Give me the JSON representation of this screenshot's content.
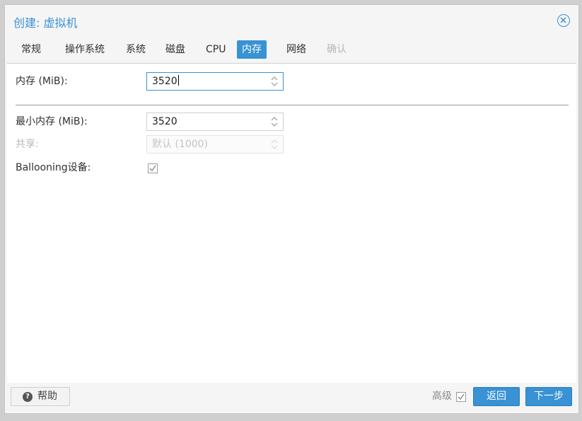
{
  "dialog": {
    "title": "创建: 虚拟机",
    "close_icon": "close-circle-icon"
  },
  "tabs": [
    {
      "label": "常规",
      "state": "normal"
    },
    {
      "label": "操作系统",
      "state": "normal"
    },
    {
      "label": "系统",
      "state": "normal"
    },
    {
      "label": "磁盘",
      "state": "normal"
    },
    {
      "label": "CPU",
      "state": "normal"
    },
    {
      "label": "内存",
      "state": "active"
    },
    {
      "label": "网络",
      "state": "normal"
    },
    {
      "label": "确认",
      "state": "disabled"
    }
  ],
  "form": {
    "memory": {
      "label": "内存 (MiB):",
      "value": "3520"
    },
    "min_memory": {
      "label": "最小内存 (MiB):",
      "value": "3520"
    },
    "shares": {
      "label": "共享:",
      "placeholder": "默认 (1000)"
    },
    "ballooning": {
      "label": "Ballooning设备:",
      "checked": true
    }
  },
  "footer": {
    "help_label": "帮助",
    "advanced_label": "高级",
    "advanced_checked": true,
    "back_label": "返回",
    "next_label": "下一步"
  },
  "colors": {
    "accent": "#3892d4",
    "disabled_text": "#b8b8b8"
  }
}
